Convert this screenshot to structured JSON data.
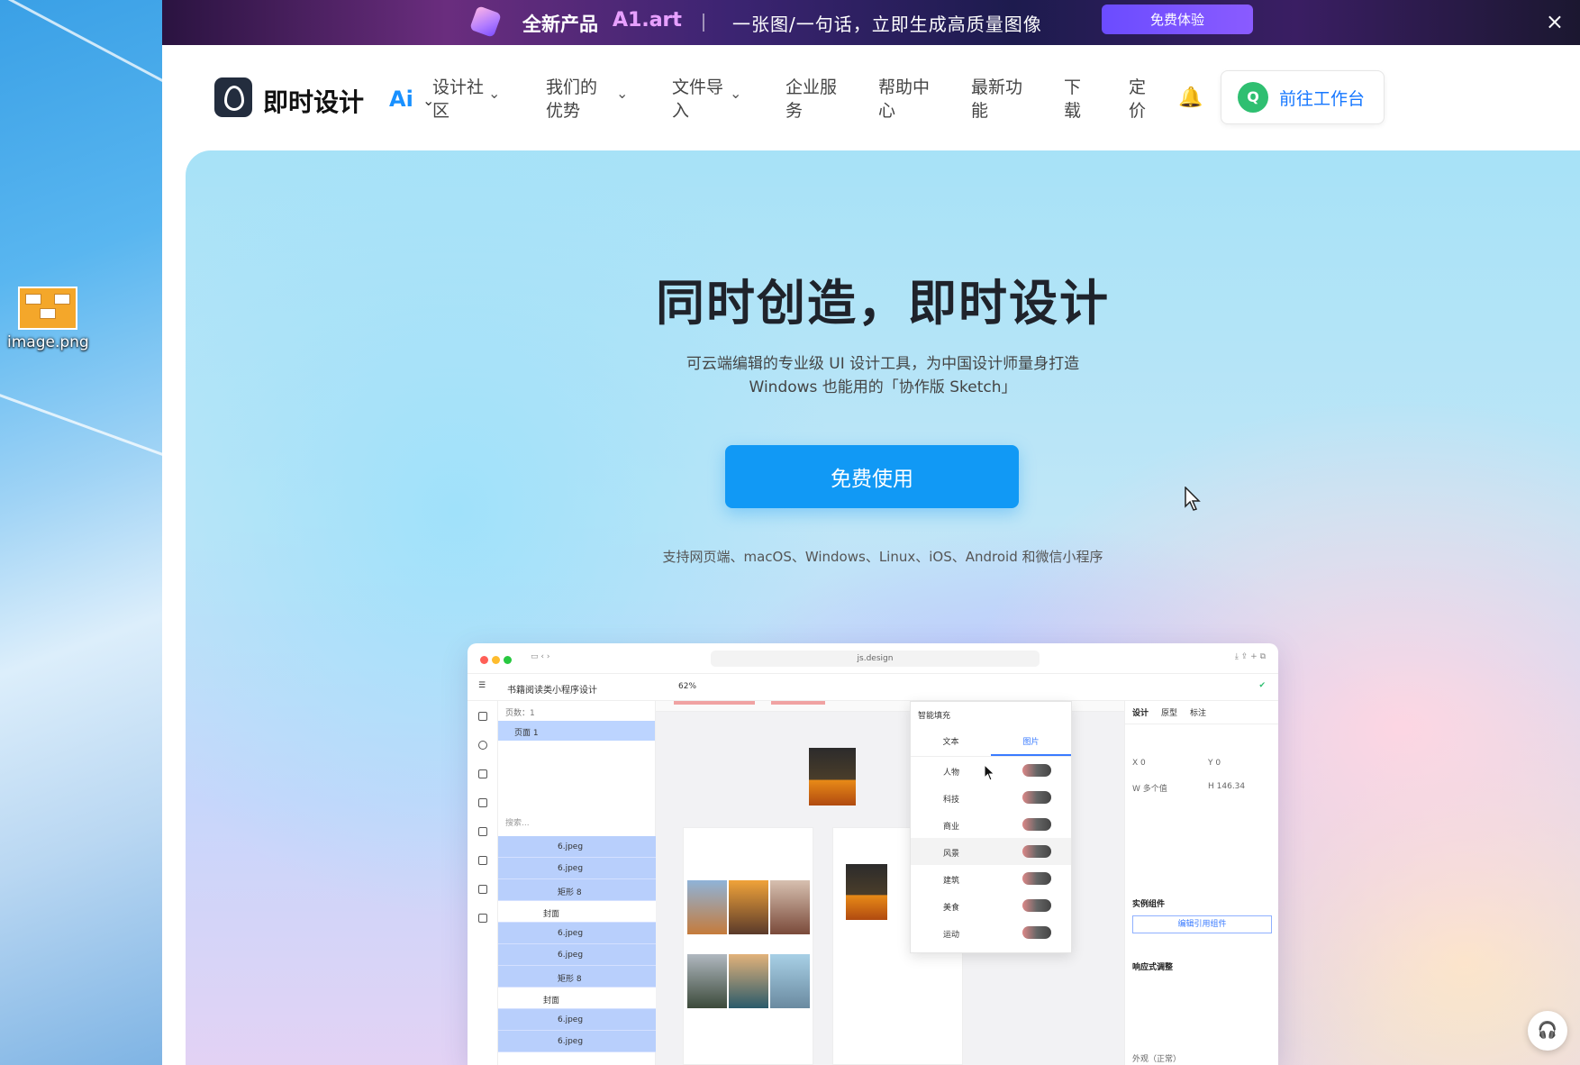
{
  "desktop": {
    "icon_label": "image.png"
  },
  "promo": {
    "product": "全新产品",
    "brand": "A1.art",
    "slogan": "一张图/一句话，立即生成高质量图像",
    "try_label": "免费体验",
    "close_icon": "×"
  },
  "nav": {
    "brand": "即时设计",
    "ai": "Ai",
    "items": [
      {
        "label": "设计社区",
        "line1": "设计社",
        "line2": "区"
      },
      {
        "label": "我们的优势",
        "line1": "我们的",
        "line2": "优势"
      },
      {
        "label": "文件导入",
        "line1": "文件导",
        "line2": "入"
      },
      {
        "label": "企业服务",
        "line1": "企业服",
        "line2": "务"
      },
      {
        "label": "帮助中心",
        "line1": "帮助中",
        "line2": "心"
      },
      {
        "label": "最新功能",
        "line1": "最新功",
        "line2": "能"
      },
      {
        "label": "下载",
        "line1": "下",
        "line2": "载"
      },
      {
        "label": "定价",
        "line1": "定",
        "line2": "价"
      }
    ],
    "workbench_avatar": "Q",
    "workbench_label": "前往工作台"
  },
  "hero": {
    "title": "同时创造，即时设计",
    "subtitle_line1": "可云端编辑的专业级 UI 设计工具，为中国设计师量身打造",
    "subtitle_line2": "Windows 也能用的「协作版 Sketch」",
    "cta_label": "免费使用",
    "platforms": "支持网页端、macOS、Windows、Linux、iOS、Android 和微信小程序"
  },
  "mockup": {
    "url": "js.design",
    "file_name": "书籍阅读类小程序设计",
    "zoom": "62%",
    "pages_header": "页数：1",
    "page_name": "页面 1",
    "search_placeholder": "搜索...",
    "layers": [
      {
        "label": "6.jpeg",
        "group": false
      },
      {
        "label": "6.jpeg",
        "group": false
      },
      {
        "label": "矩形 8",
        "group": false
      },
      {
        "label": "封面",
        "group": true
      },
      {
        "label": "6.jpeg",
        "group": false
      },
      {
        "label": "6.jpeg",
        "group": false
      },
      {
        "label": "矩形 8",
        "group": false
      },
      {
        "label": "封面",
        "group": true
      },
      {
        "label": "6.jpeg",
        "group": false
      },
      {
        "label": "6.jpeg",
        "group": false
      }
    ],
    "smart_fill": {
      "title": "智能填充",
      "tab_text": "文本",
      "tab_image": "图片",
      "categories": [
        "人物",
        "科技",
        "商业",
        "风景",
        "建筑",
        "美食",
        "运动"
      ]
    },
    "props": {
      "tab_design": "设计",
      "tab_prototype": "原型",
      "tab_annotate": "标注",
      "x_value": "0",
      "y_value": "0",
      "w_value": "多个值",
      "h_value": "146.34",
      "instance_section": "实例组件",
      "edit_button": "编辑引用组件",
      "responsive_section": "响应式调整",
      "appearance_section": "外观（正常）"
    }
  }
}
